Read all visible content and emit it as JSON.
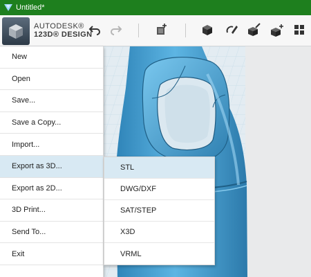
{
  "window": {
    "title": "Untitled*"
  },
  "brand": {
    "line1": "AUTODESK®",
    "line2": "123D® DESIGN"
  },
  "toolbar": {
    "icons": [
      "undo-icon",
      "redo-icon",
      "add-box-icon",
      "primitives-icon",
      "sketch-icon",
      "construct-icon",
      "modify-icon",
      "pattern-icon"
    ]
  },
  "menu": {
    "items": [
      {
        "label": "New"
      },
      {
        "label": "Open"
      },
      {
        "label": "Save..."
      },
      {
        "label": "Save a Copy..."
      },
      {
        "label": "Import..."
      },
      {
        "label": "Export as 3D..."
      },
      {
        "label": "Export as 2D..."
      },
      {
        "label": "3D Print..."
      },
      {
        "label": "Send To..."
      },
      {
        "label": "Exit"
      }
    ],
    "active_index": 5
  },
  "submenu": {
    "items": [
      {
        "label": "STL"
      },
      {
        "label": "DWG/DXF"
      },
      {
        "label": "SAT/STEP"
      },
      {
        "label": "X3D"
      },
      {
        "label": "VRML"
      }
    ],
    "active_index": 0
  },
  "colors": {
    "titlebar": "#1e7f1e",
    "highlight": "#d8e9f3",
    "model": "#4ea8d8",
    "grid": "#c6dce9"
  }
}
